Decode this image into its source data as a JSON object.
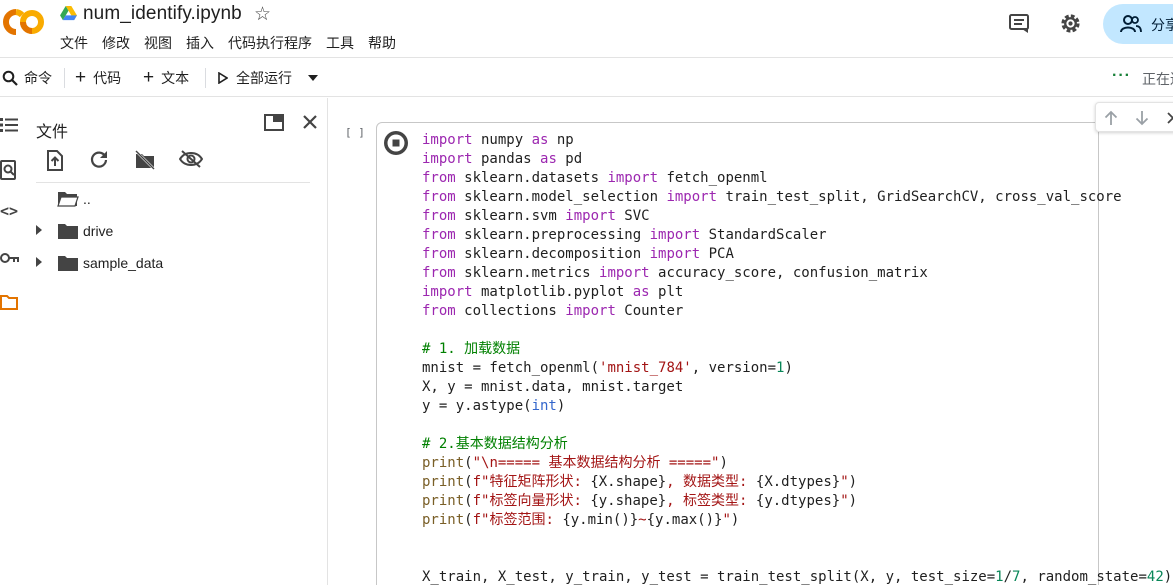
{
  "app": {
    "logo_text": "CO",
    "brand_colors": [
      "#f9ab00",
      "#e37400"
    ]
  },
  "notebook": {
    "title": "num_identify.ipynb"
  },
  "menu": [
    "文件",
    "修改",
    "视图",
    "插入",
    "代码执行程序",
    "工具",
    "帮助"
  ],
  "header_right": {
    "share_label": "分享"
  },
  "toolbar": {
    "command_label": "命令",
    "add_code_label": "代码",
    "add_text_label": "文本",
    "run_all_label": "全部运行",
    "status_label": "正在连接"
  },
  "files_panel": {
    "title": "文件",
    "tree": [
      {
        "name": "..",
        "expandable": false
      },
      {
        "name": "drive",
        "expandable": true
      },
      {
        "name": "sample_data",
        "expandable": true
      }
    ]
  },
  "cell": {
    "exec_count": "[ ]",
    "code_lines": [
      [
        [
          "kw",
          "import"
        ],
        [
          "plain",
          " numpy "
        ],
        [
          "kw",
          "as"
        ],
        [
          "plain",
          " np"
        ]
      ],
      [
        [
          "kw",
          "import"
        ],
        [
          "plain",
          " pandas "
        ],
        [
          "kw",
          "as"
        ],
        [
          "plain",
          " pd"
        ]
      ],
      [
        [
          "kw",
          "from"
        ],
        [
          "plain",
          " sklearn.datasets "
        ],
        [
          "kw",
          "import"
        ],
        [
          "plain",
          " fetch_openml"
        ]
      ],
      [
        [
          "kw",
          "from"
        ],
        [
          "plain",
          " sklearn.model_selection "
        ],
        [
          "kw",
          "import"
        ],
        [
          "plain",
          " train_test_split, GridSearchCV, cross_val_score"
        ]
      ],
      [
        [
          "kw",
          "from"
        ],
        [
          "plain",
          " sklearn.svm "
        ],
        [
          "kw",
          "import"
        ],
        [
          "plain",
          " SVC"
        ]
      ],
      [
        [
          "kw",
          "from"
        ],
        [
          "plain",
          " sklearn.preprocessing "
        ],
        [
          "kw",
          "import"
        ],
        [
          "plain",
          " StandardScaler"
        ]
      ],
      [
        [
          "kw",
          "from"
        ],
        [
          "plain",
          " sklearn.decomposition "
        ],
        [
          "kw",
          "import"
        ],
        [
          "plain",
          " PCA"
        ]
      ],
      [
        [
          "kw",
          "from"
        ],
        [
          "plain",
          " sklearn.metrics "
        ],
        [
          "kw",
          "import"
        ],
        [
          "plain",
          " accuracy_score, confusion_matrix"
        ]
      ],
      [
        [
          "kw",
          "import"
        ],
        [
          "plain",
          " matplotlib.pyplot "
        ],
        [
          "kw",
          "as"
        ],
        [
          "plain",
          " plt"
        ]
      ],
      [
        [
          "kw",
          "from"
        ],
        [
          "plain",
          " collections "
        ],
        [
          "kw",
          "import"
        ],
        [
          "plain",
          " Counter"
        ]
      ],
      [],
      [
        [
          "cm",
          "# 1. 加载数据"
        ]
      ],
      [
        [
          "plain",
          "mnist = fetch_openml("
        ],
        [
          "str",
          "'mnist_784'"
        ],
        [
          "plain",
          ", version="
        ],
        [
          "num",
          "1"
        ],
        [
          "plain",
          ")"
        ]
      ],
      [
        [
          "plain",
          "X, y = mnist.data, mnist.target"
        ]
      ],
      [
        [
          "plain",
          "y = y.astype("
        ],
        [
          "bi",
          "int"
        ],
        [
          "plain",
          ")"
        ]
      ],
      [],
      [
        [
          "cm",
          "# 2.基本数据结构分析"
        ]
      ],
      [
        [
          "fn",
          "print"
        ],
        [
          "plain",
          "("
        ],
        [
          "str",
          "\"\\n===== 基本数据结构分析 =====\""
        ],
        [
          "plain",
          ")"
        ]
      ],
      [
        [
          "fn",
          "print"
        ],
        [
          "plain",
          "("
        ],
        [
          "str",
          "f\"特征矩阵形状: "
        ],
        [
          "plain",
          "{X.shape}"
        ],
        [
          "str",
          ", 数据类型: "
        ],
        [
          "plain",
          "{X.dtypes}"
        ],
        [
          "str",
          "\""
        ],
        [
          "plain",
          ")"
        ]
      ],
      [
        [
          "fn",
          "print"
        ],
        [
          "plain",
          "("
        ],
        [
          "str",
          "f\"标签向量形状: "
        ],
        [
          "plain",
          "{y.shape}"
        ],
        [
          "str",
          ", 标签类型: "
        ],
        [
          "plain",
          "{y.dtypes}"
        ],
        [
          "str",
          "\""
        ],
        [
          "plain",
          ")"
        ]
      ],
      [
        [
          "fn",
          "print"
        ],
        [
          "plain",
          "("
        ],
        [
          "str",
          "f\"标签范围: "
        ],
        [
          "plain",
          "{y.min()}"
        ],
        [
          "str",
          "~"
        ],
        [
          "plain",
          "{y.max()}"
        ],
        [
          "str",
          "\""
        ],
        [
          "plain",
          ")"
        ]
      ],
      [],
      [],
      [
        [
          "plain",
          "X_train, X_test, y_train, y_test = train_test_split(X, y, test_size="
        ],
        [
          "num",
          "1"
        ],
        [
          "plain",
          "/"
        ],
        [
          "num",
          "7"
        ],
        [
          "plain",
          ", random_state="
        ],
        [
          "num",
          "42"
        ],
        [
          "plain",
          ")"
        ]
      ]
    ]
  },
  "colors": {
    "accent": "#0b57d0",
    "share_bg": "#c2e7ff",
    "keyword": "#9c27b0",
    "comment": "#008000",
    "string": "#a31515"
  }
}
